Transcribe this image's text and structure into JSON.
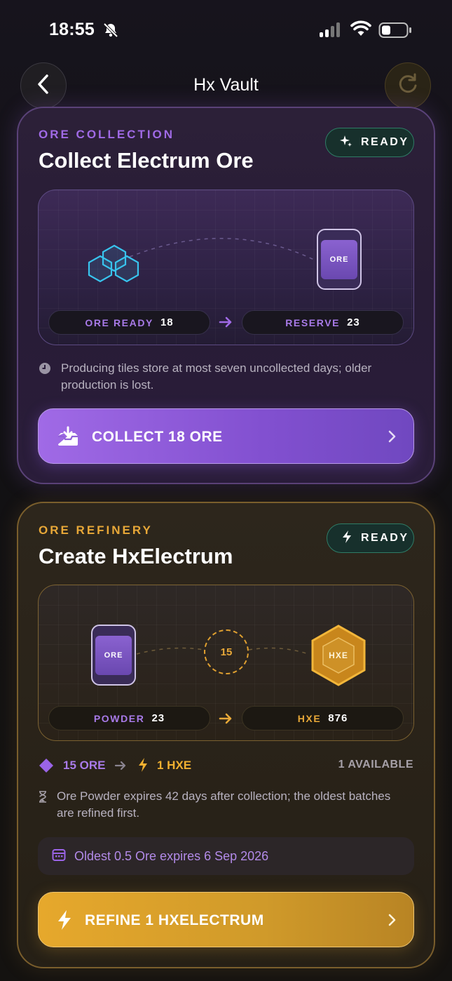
{
  "status_bar": {
    "time": "18:55"
  },
  "header": {
    "title": "Hx Vault"
  },
  "ore_card": {
    "eyebrow": "ORE COLLECTION",
    "title": "Collect Electrum Ore",
    "badge": "READY",
    "chip_label": "ORE",
    "ore_ready_label": "ORE READY",
    "ore_ready_value": "18",
    "reserve_label": "RESERVE",
    "reserve_value": "23",
    "note": "Producing tiles store at most seven uncollected days; older production is lost.",
    "cta": "COLLECT 18 ORE"
  },
  "refinery_card": {
    "eyebrow": "ORE REFINERY",
    "title": "Create HxElectrum",
    "badge": "READY",
    "chip_label": "ORE",
    "ring_value": "15",
    "hex_label": "HXE",
    "powder_label": "POWDER",
    "powder_value": "23",
    "hxe_label": "HXE",
    "hxe_value": "876",
    "rate_input": "15 ORE",
    "rate_output": "1 HXE",
    "available": "1 AVAILABLE",
    "note": "Ore Powder expires 42 days after collection; the oldest batches are refined first.",
    "expiry": "Oldest 0.5 Ore expires 6 Sep 2026",
    "cta": "REFINE 1 HXELECTRUM"
  },
  "colors": {
    "purple_accent": "#a06ae6",
    "gold_accent": "#e6a82c",
    "ready_green": "#2f7c66"
  }
}
